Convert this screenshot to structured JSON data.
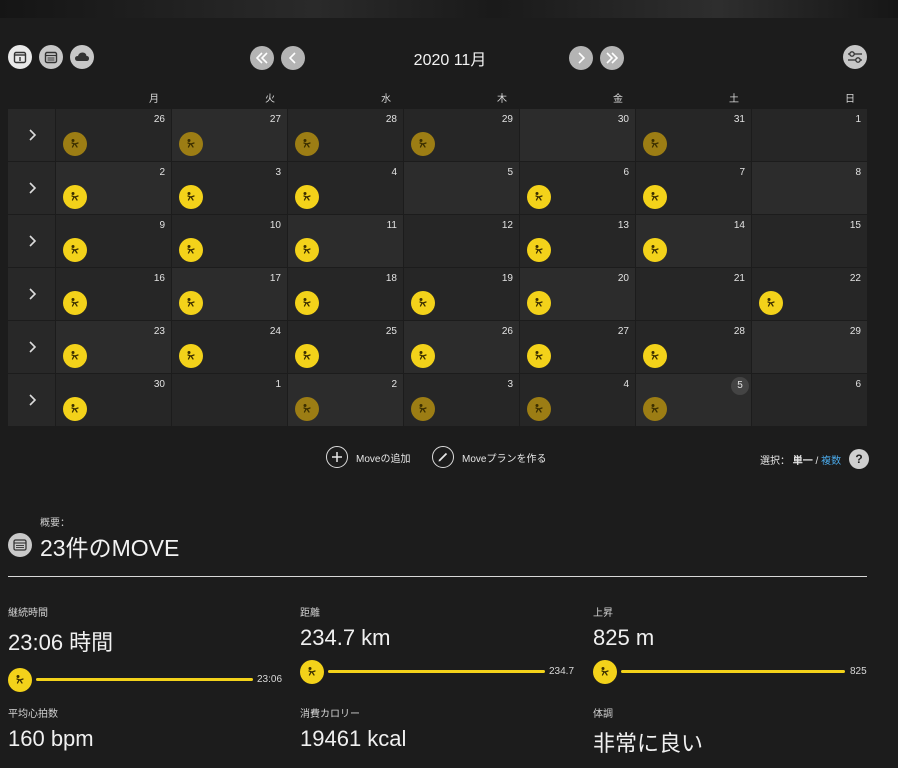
{
  "header": {
    "title": "2020 11月",
    "icons": [
      "calendar-day-icon",
      "calendar-month-icon",
      "cloud-icon",
      "settings-sliders-icon"
    ]
  },
  "weekdays": [
    "月",
    "火",
    "水",
    "木",
    "金",
    "土",
    "日"
  ],
  "weeks": [
    {
      "days": [
        {
          "num": "26",
          "act": "dim"
        },
        {
          "num": "27",
          "act": "dim"
        },
        {
          "num": "28",
          "act": "dim"
        },
        {
          "num": "29",
          "act": "dim"
        },
        {
          "num": "30",
          "act": ""
        },
        {
          "num": "31",
          "act": "dim"
        },
        {
          "num": "1",
          "act": ""
        }
      ]
    },
    {
      "days": [
        {
          "num": "2",
          "act": "bright"
        },
        {
          "num": "3",
          "act": "bright"
        },
        {
          "num": "4",
          "act": "bright"
        },
        {
          "num": "5",
          "act": ""
        },
        {
          "num": "6",
          "act": "bright"
        },
        {
          "num": "7",
          "act": "bright"
        },
        {
          "num": "8",
          "act": ""
        }
      ]
    },
    {
      "days": [
        {
          "num": "9",
          "act": "bright"
        },
        {
          "num": "10",
          "act": "bright"
        },
        {
          "num": "11",
          "act": "bright"
        },
        {
          "num": "12",
          "act": ""
        },
        {
          "num": "13",
          "act": "bright"
        },
        {
          "num": "14",
          "act": "bright"
        },
        {
          "num": "15",
          "act": ""
        }
      ]
    },
    {
      "days": [
        {
          "num": "16",
          "act": "bright"
        },
        {
          "num": "17",
          "act": "bright"
        },
        {
          "num": "18",
          "act": "bright"
        },
        {
          "num": "19",
          "act": "bright"
        },
        {
          "num": "20",
          "act": "bright"
        },
        {
          "num": "21",
          "act": ""
        },
        {
          "num": "22",
          "act": "bright"
        }
      ]
    },
    {
      "days": [
        {
          "num": "23",
          "act": "bright"
        },
        {
          "num": "24",
          "act": "bright"
        },
        {
          "num": "25",
          "act": "bright"
        },
        {
          "num": "26",
          "act": "bright"
        },
        {
          "num": "27",
          "act": "bright"
        },
        {
          "num": "28",
          "act": "bright"
        },
        {
          "num": "29",
          "act": ""
        }
      ]
    },
    {
      "days": [
        {
          "num": "30",
          "act": "bright"
        },
        {
          "num": "1",
          "act": ""
        },
        {
          "num": "2",
          "act": "dim"
        },
        {
          "num": "3",
          "act": "dim"
        },
        {
          "num": "4",
          "act": "dim"
        },
        {
          "num": "5",
          "act": "dim",
          "today": true
        },
        {
          "num": "6",
          "act": ""
        }
      ]
    }
  ],
  "actions": {
    "add_move": "Moveの追加",
    "create_plan": "Moveプランを作る",
    "select_prefix": "選択：",
    "select_single": "単一",
    "select_sep": " / ",
    "select_multiple": "複数",
    "help": "?"
  },
  "summary": {
    "label": "概要：",
    "count": "23件のMOVE"
  },
  "stats": {
    "duration": {
      "label": "継続時間",
      "value": "23:06 時間",
      "bar_value": "23:06"
    },
    "distance": {
      "label": "距離",
      "value": "234.7 km",
      "bar_value": "234.7"
    },
    "ascent": {
      "label": "上昇",
      "value": "825 m",
      "bar_value": "825"
    },
    "heart_rate": {
      "label": "平均心拍数",
      "value": "160 bpm"
    },
    "calories": {
      "label": "消費カロリー",
      "value": "19461 kcal"
    },
    "feeling": {
      "label": "体調",
      "value": "非常に良い"
    }
  },
  "colors": {
    "accent": "#f3d21a",
    "accent_dim": "#9c7d14",
    "link": "#4aa8e8",
    "background": "#1c1c1c"
  }
}
